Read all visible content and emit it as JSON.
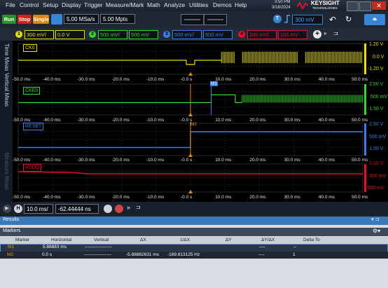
{
  "menu": [
    "File",
    "Control",
    "Setup",
    "Display",
    "Trigger",
    "Measure/Mark",
    "Math",
    "Analyze",
    "Utilities",
    "Demos",
    "Help"
  ],
  "clock": {
    "time": "3:50 PM",
    "date": "3/18/2024"
  },
  "brand": {
    "name": "KEYSIGHT",
    "sub": "TECHNOLOGIES"
  },
  "toolbar": {
    "run": "Run",
    "stop": "Stop",
    "single": "Single",
    "sample_rate": "5.00 MSa/s",
    "memory": "5.00 Mpts",
    "trigger_level": "300 mV"
  },
  "channels": [
    {
      "num": "1",
      "scale": "300 mV/",
      "offset": "0.0 V",
      "color": "#e8e000"
    },
    {
      "num": "2",
      "scale": "500 mV/",
      "offset": "500 mV",
      "color": "#39d42f"
    },
    {
      "num": "3",
      "scale": "500 mV/",
      "offset": "500 mV",
      "color": "#3a7fe8"
    },
    {
      "num": "4",
      "scale": "200 mV/",
      "offset": "100 mV",
      "color": "#e8102f"
    }
  ],
  "side_tabs": [
    "Time Meas",
    "Vertical Meas",
    "Measure Meas"
  ],
  "time_axis": [
    "-50.0 ms",
    "-40.0 ms",
    "-30.0 ms",
    "-20.0 ms",
    "-10.0 ms",
    "-0.0 s",
    "10.0 ms",
    "20.0 ms",
    "30.0 ms",
    "40.0 ms",
    "50.0 ms"
  ],
  "signals": [
    {
      "name": "CK0",
      "color": "#e8e000",
      "ticks": [
        "1.20 V",
        "0.0 V",
        "-1.20 V"
      ]
    },
    {
      "name": "CKE0",
      "color": "#39d42f",
      "ticks": [
        "2.50 V",
        "500 mV",
        "-1.50 V"
      ]
    },
    {
      "name": "RESET",
      "color": "#3a7fe8",
      "ticks": [
        "2.50 V",
        "500 mV",
        "-1.50 V"
      ]
    },
    {
      "name": "VDDQ",
      "color": "#e8102f",
      "ticks": [
        "1.10 V",
        "300 mV",
        "-500 mV"
      ]
    }
  ],
  "markers": {
    "m1": "M1",
    "m2": "M2"
  },
  "horizontal": {
    "scale": "10.0 ms/",
    "position": "-62.44444 ns"
  },
  "results": {
    "title": "Results",
    "section": "Markers",
    "headers": [
      "Marker",
      "Horizontal",
      "Vertical",
      "ΔX",
      "1/ΔX",
      "ΔY",
      "ΔY/ΔX",
      "Delta To"
    ],
    "rows": [
      {
        "marker": "M1",
        "horizontal": "5.88883 ms",
        "vertical": "------------------",
        "dx": "",
        "inv_dx": "",
        "dy": "",
        "dy_dx": "----",
        "delta_to": "--",
        "color": "#e8a000"
      },
      {
        "marker": "M2",
        "horizontal": "0.0 s",
        "vertical": "------------------",
        "dx": "-5.88882631 ms",
        "inv_dx": "-169.813125 Hz",
        "dy": "",
        "dy_dx": "----",
        "delta_to": "1",
        "color": "#e8a000"
      }
    ]
  }
}
